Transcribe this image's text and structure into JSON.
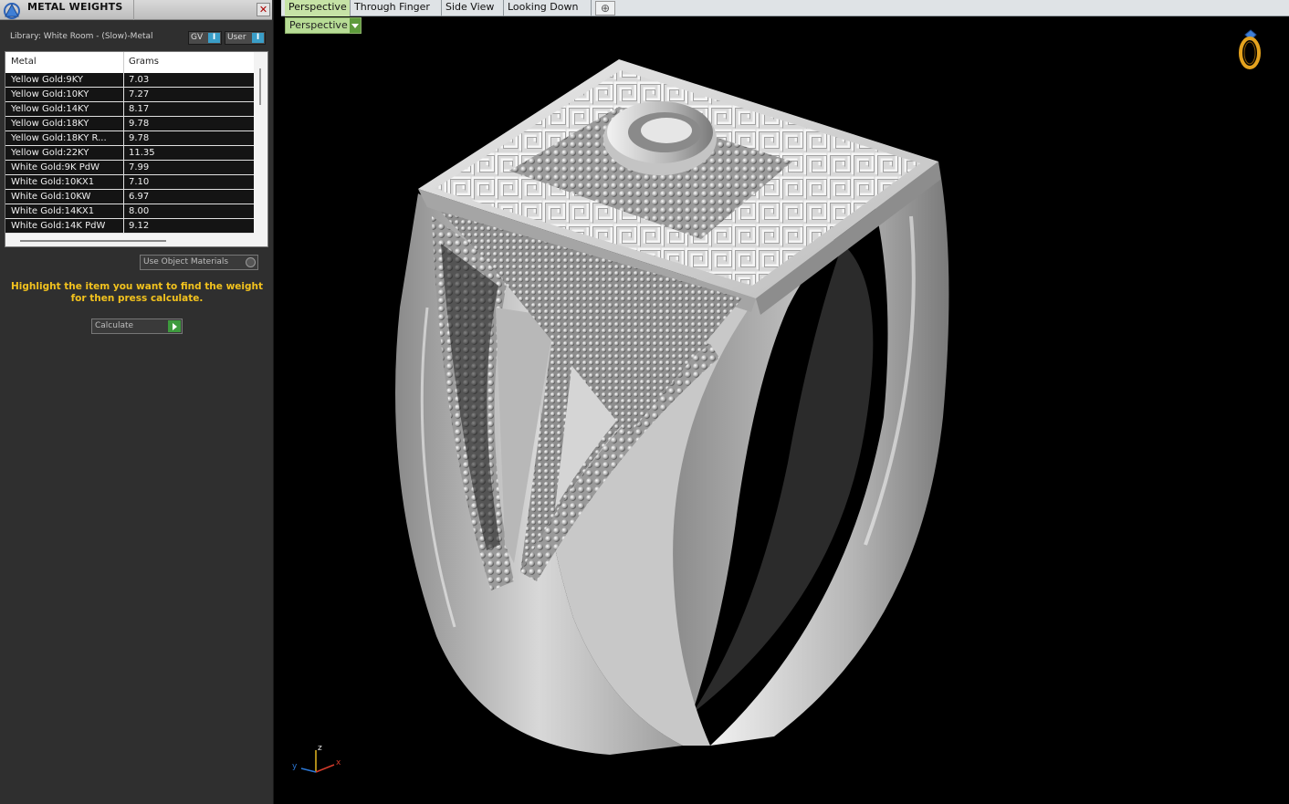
{
  "panel": {
    "title": "METAL WEIGHTS",
    "close_glyph": "✕",
    "library_label": "Library: White Room - (Slow)-Metal",
    "toggle_gv": "GV",
    "toggle_user": "User",
    "toggle_knob": "I",
    "table": {
      "columns": [
        "Metal",
        "Grams"
      ],
      "rows": [
        {
          "metal": "Yellow Gold:9KY",
          "grams": "7.03"
        },
        {
          "metal": "Yellow Gold:10KY",
          "grams": "7.27"
        },
        {
          "metal": "Yellow Gold:14KY",
          "grams": "8.17"
        },
        {
          "metal": "Yellow Gold:18KY",
          "grams": "9.78"
        },
        {
          "metal": "Yellow Gold:18KY R...",
          "grams": "9.78"
        },
        {
          "metal": "Yellow Gold:22KY",
          "grams": "11.35"
        },
        {
          "metal": "White Gold:9K PdW",
          "grams": "7.99"
        },
        {
          "metal": "White Gold:10KX1",
          "grams": "7.10"
        },
        {
          "metal": "White Gold:10KW",
          "grams": "6.97"
        },
        {
          "metal": "White Gold:14KX1",
          "grams": "8.00"
        },
        {
          "metal": "White Gold:14K PdW",
          "grams": "9.12"
        }
      ]
    },
    "use_object_materials": "Use Object Materials",
    "hint_line1": "Highlight the item you want to find the weight",
    "hint_line2": "for then press calculate.",
    "calculate_label": "Calculate"
  },
  "viewport": {
    "tabs": [
      "Perspective",
      "Through Finger",
      "Side View",
      "Looking Down"
    ],
    "active_tab": "Perspective",
    "add_tab_glyph": "⊕",
    "view_mode": "Perspective",
    "axes": {
      "x": "x",
      "y": "y",
      "z": "z"
    },
    "icons": [
      "ring-logo-icon",
      "axis-gizmo-icon",
      "app-logo-icon"
    ],
    "colors": {
      "tab_active": "#c6e3a6",
      "hint": "#f2c21e",
      "background": "#000000"
    }
  }
}
